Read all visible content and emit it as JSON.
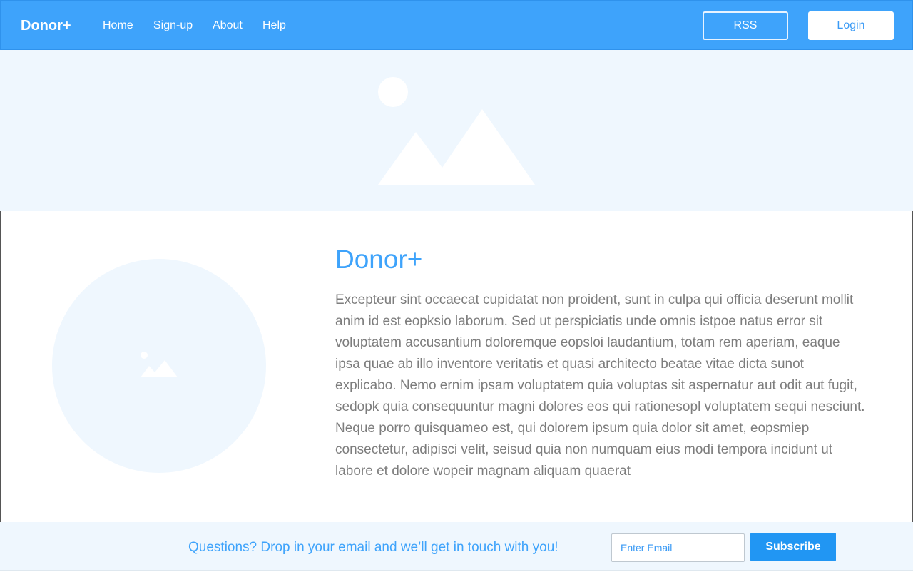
{
  "navbar": {
    "brand": "Donor+",
    "links": [
      "Home",
      "Sign-up",
      "About",
      "Help"
    ],
    "rss_label": "RSS",
    "login_label": "Login"
  },
  "hero": {
    "image_icon": "image-placeholder-icon"
  },
  "content": {
    "image_icon": "image-placeholder-icon",
    "title": "Donor+",
    "body": "Excepteur sint occaecat cupidatat non proident, sunt in culpa qui officia deserunt mollit anim id est eopksio laborum. Sed ut perspiciatis unde omnis istpoe natus error sit voluptatem accusantium doloremque eopsloi laudantium, totam rem aperiam, eaque ipsa quae ab illo inventore veritatis et quasi architecto beatae vitae dicta sunot explicabo. Nemo ernim ipsam voluptatem quia voluptas sit aspernatur aut odit aut fugit, sedopk quia consequuntur magni dolores eos qui rationesopl voluptatem sequi nesciunt. Neque porro quisquameo est, qui dolorem ipsum quia dolor sit amet, eopsmiep consectetur, adipisci velit, seisud quia non numquam eius modi tempora incidunt ut labore et dolore wopeir magnam aliquam quaerat"
  },
  "footer": {
    "text": "Questions? Drop in your email and we’ll get in touch with you!",
    "email_placeholder": "Enter Email",
    "subscribe_label": "Subscribe"
  },
  "colors": {
    "primary": "#3ea3fb",
    "light_bg": "#eff7fe",
    "body_text": "#7d7d7d",
    "button_blue": "#2196f3"
  }
}
